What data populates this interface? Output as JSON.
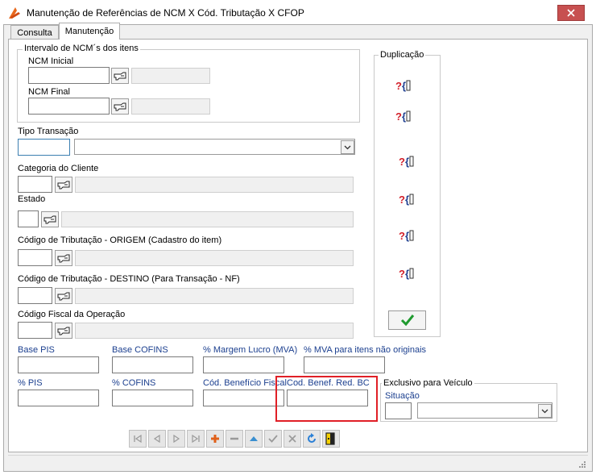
{
  "window": {
    "title": "Manutenção de Referências de NCM X Cód. Tributação X CFOP"
  },
  "tabs": [
    {
      "label": "Consulta",
      "active": false
    },
    {
      "label": "Manutenção",
      "active": true
    }
  ],
  "ncm_group": {
    "title": "Intervalo de NCM´s  dos itens",
    "ncm_inicial_label": "NCM Inicial",
    "ncm_final_label": "NCM Final"
  },
  "duplicacao": {
    "title": "Duplicação"
  },
  "fields": {
    "tipo_transacao": "Tipo Transação",
    "categoria_cliente": "Categoria do Cliente",
    "estado": "Estado",
    "cod_trib_origem": "Código de Tributação - ORIGEM (Cadastro do item)",
    "cod_trib_destino": "Código de Tributação - DESTINO (Para Transação - NF)",
    "cfop": "Código Fiscal da Operação"
  },
  "rates": {
    "base_pis": "Base PIS",
    "base_cofins": "Base COFINS",
    "margem_lucro": "% Margem Lucro (MVA)",
    "mva_nao_originais": "% MVA para itens não originais",
    "pis": "% PIS",
    "cofins": "% COFINS",
    "cod_beneficio_fiscal": "Cód. Benefício Fiscal",
    "cod_benef_red_bc": "Cod. Benef. Red. BC"
  },
  "veiculo": {
    "title": "Exclusivo para Veículo",
    "situacao_label": "Situação"
  },
  "colors": {
    "highlight": "#e01f26",
    "label_blue": "#1b3f8f",
    "confirm_green": "#1f9a2f",
    "add_orange": "#e0601a",
    "refresh_blue": "#2a7fd6"
  }
}
